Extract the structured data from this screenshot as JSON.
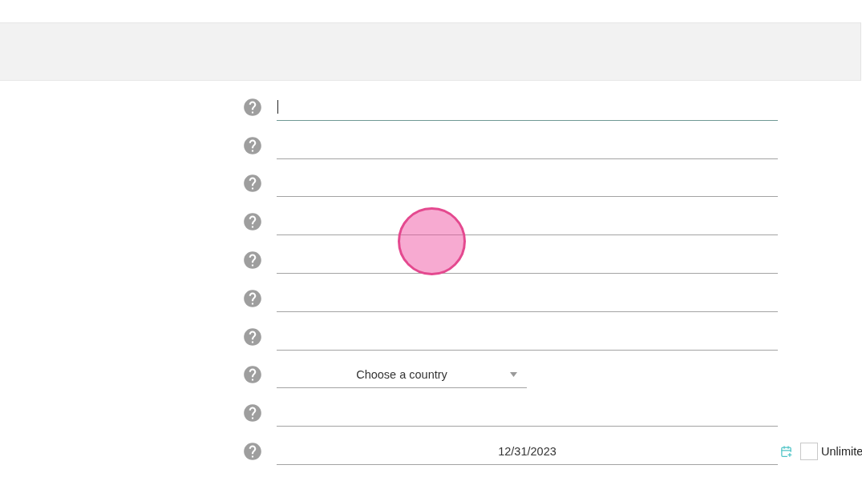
{
  "fields": [
    {
      "kind": "text",
      "focused": true
    },
    {
      "kind": "text",
      "focused": false
    },
    {
      "kind": "text",
      "focused": false
    },
    {
      "kind": "text",
      "focused": false
    },
    {
      "kind": "text",
      "focused": false
    },
    {
      "kind": "text",
      "focused": false
    },
    {
      "kind": "text",
      "focused": false
    },
    {
      "kind": "select",
      "focused": false,
      "value": "Choose a country"
    },
    {
      "kind": "text",
      "focused": false
    },
    {
      "kind": "date",
      "focused": false,
      "value": "12/31/2023",
      "unlimited": {
        "label": "Unlimite",
        "checked": false
      }
    }
  ]
}
